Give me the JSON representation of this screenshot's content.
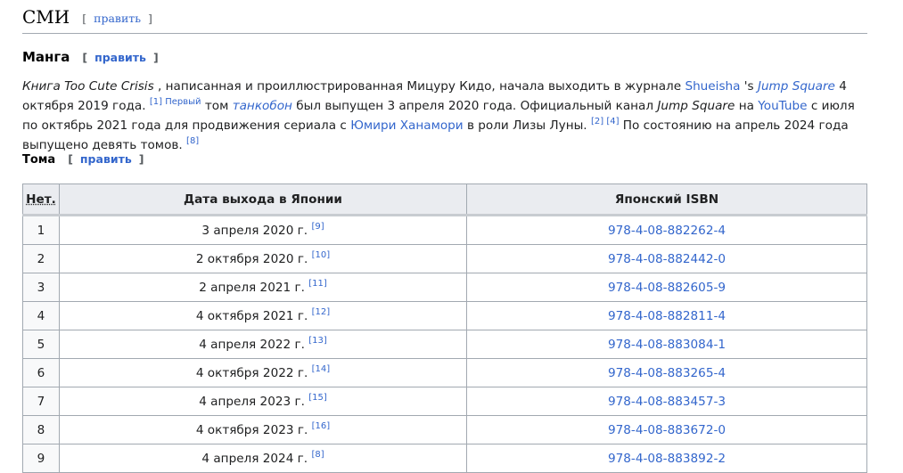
{
  "section": {
    "title": "СМИ",
    "edit_label": "править"
  },
  "subsection": {
    "title": "Манга",
    "edit_label": "править"
  },
  "paragraph": {
    "p1": "Книга Too Cute Crisis",
    "p2": " , написанная и проиллюстрированная Мицуру Кидо, начала выходить в журнале ",
    "link_shueisha": "Shueisha",
    "p3": " 's ",
    "link_jump": "Jump Square",
    "p4": " 4 октября 2019 года. ",
    "ref1": "[1] Первый",
    "p5": " том ",
    "link_tankobon": "танкобон",
    "p6": " был выпущен 3 апреля 2020 года. Официальный канал ",
    "p7": "Jump Square",
    "p8": " на ",
    "link_youtube": "YouTube",
    "p9": " с июля по октябрь 2021 года для продвижения сериала с ",
    "link_yumiri": "Юмири Ханамори",
    "p10": " в роли Лизы Луны. ",
    "ref2": "[2]",
    "ref4": "[4]",
    "p11": " По состоянию на апрель 2024 года выпущено девять томов. ",
    "ref8": "[8]"
  },
  "volumes_heading": {
    "title": "Тома",
    "edit_label": "править"
  },
  "table": {
    "headers": {
      "num": "Нет.",
      "date": "Дата выхода в Японии",
      "isbn": "Японский ISBN"
    },
    "rows": [
      {
        "num": "1",
        "date": "3 апреля 2020 г.",
        "ref": "[9]",
        "isbn": "978-4-08-882262-4"
      },
      {
        "num": "2",
        "date": "2 октября 2020 г.",
        "ref": "[10]",
        "isbn": "978-4-08-882442-0"
      },
      {
        "num": "3",
        "date": "2 апреля 2021 г.",
        "ref": "[11]",
        "isbn": "978-4-08-882605-9"
      },
      {
        "num": "4",
        "date": "4 октября 2021 г.",
        "ref": "[12]",
        "isbn": "978-4-08-882811-4"
      },
      {
        "num": "5",
        "date": "4 апреля 2022 г.",
        "ref": "[13]",
        "isbn": "978-4-08-883084-1"
      },
      {
        "num": "6",
        "date": "4 октября 2022 г.",
        "ref": "[14]",
        "isbn": "978-4-08-883265-4"
      },
      {
        "num": "7",
        "date": "4 апреля 2023 г.",
        "ref": "[15]",
        "isbn": "978-4-08-883457-3"
      },
      {
        "num": "8",
        "date": "4 октября 2023 г.",
        "ref": "[16]",
        "isbn": "978-4-08-883672-0"
      },
      {
        "num": "9",
        "date": "4 апреля 2024 г.",
        "ref": "[8]",
        "isbn": "978-4-08-883892-2"
      }
    ]
  }
}
